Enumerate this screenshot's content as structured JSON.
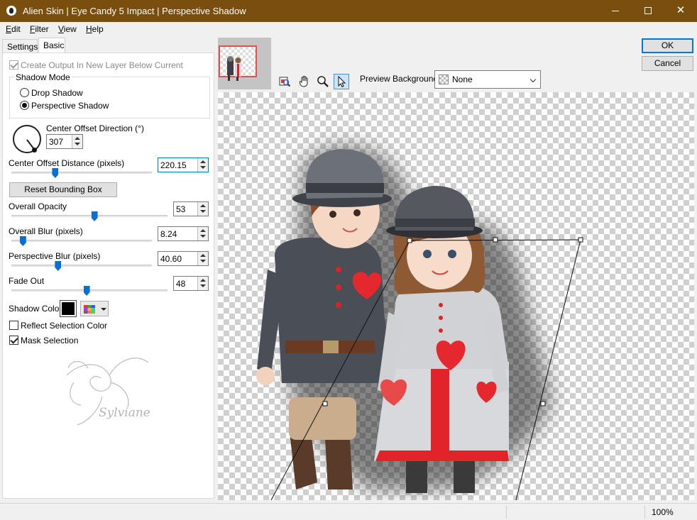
{
  "window": {
    "title": "Alien Skin | Eye Candy 5 Impact | Perspective Shadow"
  },
  "menu": {
    "items": [
      {
        "label": "Edit",
        "mnemonic": "E",
        "rest": "dit"
      },
      {
        "label": "Filter",
        "mnemonic": "F",
        "rest": "ilter"
      },
      {
        "label": "View",
        "mnemonic": "V",
        "rest": "iew"
      },
      {
        "label": "Help",
        "mnemonic": "H",
        "rest": "elp"
      }
    ]
  },
  "tabs": [
    {
      "label": "Settings",
      "active": false
    },
    {
      "label": "Basic",
      "active": true
    }
  ],
  "basic": {
    "create_output_label": "Create Output In New Layer Below Current",
    "create_output_checked": true,
    "shadow_mode": {
      "title": "Shadow Mode",
      "options": [
        {
          "label": "Drop Shadow",
          "selected": false
        },
        {
          "label": "Perspective Shadow",
          "selected": true
        }
      ]
    },
    "direction": {
      "label": "Center Offset Direction (°)",
      "value": "307"
    },
    "distance": {
      "label": "Center Offset Distance (pixels)",
      "value": "220.15",
      "slider_fraction": 0.31
    },
    "reset_button": "Reset Bounding Box",
    "opacity": {
      "label": "Overall Opacity",
      "value": "53",
      "slider_fraction": 0.53
    },
    "overall_blur": {
      "label": "Overall Blur (pixels)",
      "value": "8.24",
      "slider_fraction": 0.08
    },
    "perspective_blur": {
      "label": "Perspective Blur (pixels)",
      "value": "40.60",
      "slider_fraction": 0.33
    },
    "fade_out": {
      "label": "Fade Out",
      "value": "48",
      "slider_fraction": 0.48
    },
    "shadow_color": {
      "label": "Shadow Color",
      "color": "#000000"
    },
    "reflect_selection": {
      "label": "Reflect Selection Color",
      "checked": false
    },
    "mask_selection": {
      "label": "Mask Selection",
      "checked": true
    },
    "watermark_text": "Sylviane"
  },
  "buttons": {
    "ok": "OK",
    "cancel": "Cancel"
  },
  "toolbar": {
    "tools": [
      "navigator-icon",
      "hand-icon",
      "zoom-icon",
      "pointer-icon"
    ],
    "active_tool": "pointer-icon"
  },
  "preview": {
    "label": "Preview Background:",
    "value": "None"
  },
  "status": {
    "zoom": "100%"
  },
  "colors": {
    "titlebar": "#7a4e0e",
    "accent": "#0078d7",
    "slider_thumb": "#0a6fd4"
  }
}
